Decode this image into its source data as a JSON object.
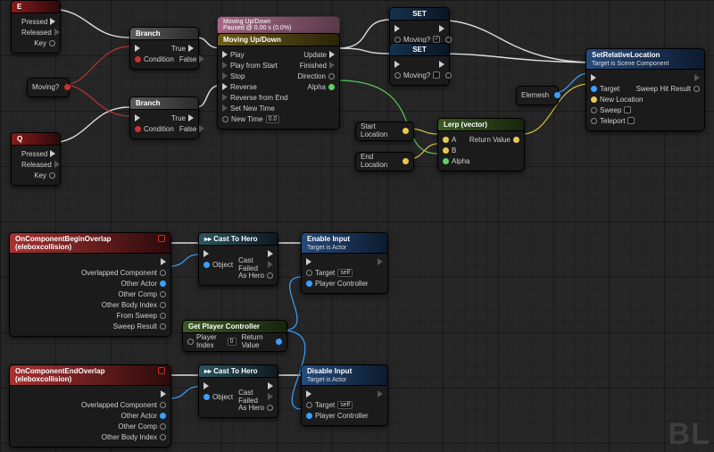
{
  "watermark": "BL",
  "nodes": {
    "eventE": {
      "title": "E",
      "p": [
        "Pressed",
        "Released",
        "Key"
      ]
    },
    "eventQ": {
      "title": "Q",
      "p": [
        "Pressed",
        "Released",
        "Key"
      ]
    },
    "moving": {
      "label": "Moving?"
    },
    "branch1": {
      "title": "Branch",
      "cond": "Condition",
      "t": "True",
      "f": "False"
    },
    "branch2": {
      "title": "Branch",
      "cond": "Condition",
      "t": "True",
      "f": "False"
    },
    "timelineHeader": "Moving Up/Down\nPaused @ 0.00 s (0.0%)",
    "timeline": {
      "title": "Moving Up/Down",
      "left": [
        "Play",
        "Play from Start",
        "Stop",
        "Reverse",
        "Reverse from End",
        "Set New Time",
        "New Time"
      ],
      "right": [
        "Update",
        "Finished",
        "Direction",
        "Alpha"
      ],
      "newtime": "0.0"
    },
    "set1": {
      "title": "SET",
      "field": "Moving?"
    },
    "set2": {
      "title": "SET",
      "field": "Moving?"
    },
    "lerp": {
      "title": "Lerp (vector)",
      "a": "A",
      "b": "B",
      "alpha": "Alpha",
      "ret": "Return Value"
    },
    "startLoc": "Start Location",
    "endLoc": "End Location",
    "elemesh": "Elemesh",
    "setRel": {
      "title": "SetRelativeLocation",
      "sub": "Target is Scene Component",
      "left": [
        "Target",
        "New Location",
        "Sweep",
        "Teleport"
      ],
      "right": [
        "Sweep Hit Result"
      ]
    },
    "beginOver": {
      "title": "OnComponentBeginOverlap (eleboxcollision)",
      "p": [
        "Overlapped Component",
        "Other Actor",
        "Other Comp",
        "Other Body Index",
        "From Sweep",
        "Sweep Result"
      ]
    },
    "endOver": {
      "title": "OnComponentEndOverlap (eleboxcollision)",
      "p": [
        "Overlapped Component",
        "Other Actor",
        "Other Comp",
        "Other Body Index"
      ]
    },
    "cast1": {
      "title": "Cast To Hero",
      "obj": "Object",
      "cf": "Cast Failed",
      "as": "As Hero"
    },
    "cast2": {
      "title": "Cast To Hero",
      "obj": "Object",
      "cf": "Cast Failed",
      "as": "As Hero"
    },
    "getPC": {
      "title": "Get Player Controller",
      "idx": "Player Index",
      "idxv": "0",
      "ret": "Return Value"
    },
    "enable": {
      "title": "Enable Input",
      "sub": "Target is Actor",
      "tgt": "Target",
      "self": "self",
      "pc": "Player Controller"
    },
    "disable": {
      "title": "Disable Input",
      "sub": "Target is Actor",
      "tgt": "Target",
      "self": "self",
      "pc": "Player Controller"
    }
  }
}
